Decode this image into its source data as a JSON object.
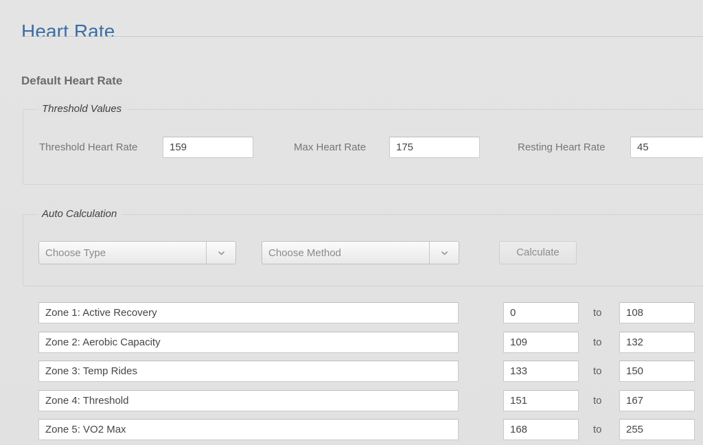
{
  "page": {
    "title": "Heart Rate",
    "section_heading": "Default Heart Rate",
    "accent_color": "#3a6ea5",
    "background_color": "#e2e2e2"
  },
  "threshold_section": {
    "legend": "Threshold Values",
    "fields": [
      {
        "label": "Threshold Heart Rate",
        "value": "159"
      },
      {
        "label": "Max Heart Rate",
        "value": "175"
      },
      {
        "label": "Resting Heart Rate",
        "value": "45"
      }
    ]
  },
  "auto_calculation": {
    "legend": "Auto Calculation",
    "type_select": {
      "value": "Choose Type",
      "icon": "chevron-down-icon"
    },
    "method_select": {
      "value": "Choose Method",
      "icon": "chevron-down-icon"
    },
    "calculate_button": "Calculate"
  },
  "zones": {
    "separator_label": "to",
    "rows": [
      {
        "name": "Zone 1: Active Recovery",
        "min": "0",
        "max": "108"
      },
      {
        "name": "Zone 2: Aerobic Capacity",
        "min": "109",
        "max": "132"
      },
      {
        "name": "Zone 3: Temp Rides",
        "min": "133",
        "max": "150"
      },
      {
        "name": "Zone 4: Threshold",
        "min": "151",
        "max": "167"
      },
      {
        "name": "Zone 5: VO2 Max",
        "min": "168",
        "max": "255"
      }
    ]
  }
}
